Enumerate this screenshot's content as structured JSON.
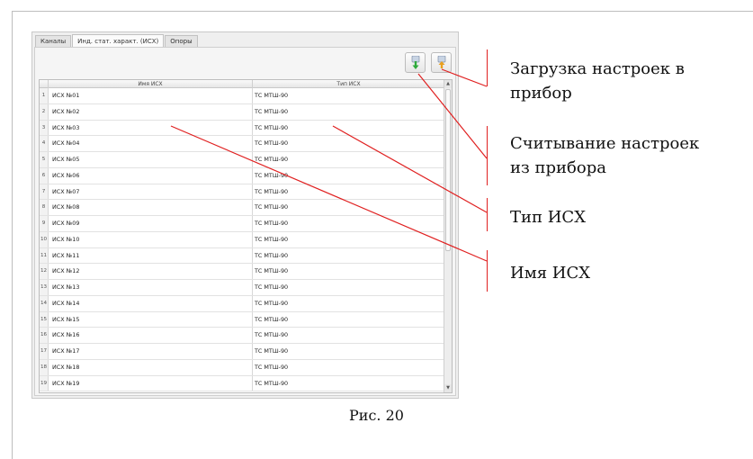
{
  "tabs": [
    {
      "label": "Каналы",
      "active": false
    },
    {
      "label": "Инд. стат. характ. (ИСХ)",
      "active": true
    },
    {
      "label": "Опоры",
      "active": false
    }
  ],
  "toolbar": {
    "load_icon": "download-to-device-icon",
    "read_icon": "read-from-device-icon",
    "load_arrow_color": "#2eaa3c",
    "read_arrow_color": "#e8a020"
  },
  "table": {
    "headers": [
      "Имя ИСХ",
      "Тип ИСХ"
    ],
    "rows": [
      {
        "num": "1",
        "name": "ИСХ №01",
        "type": "ТС МТШ-90"
      },
      {
        "num": "2",
        "name": "ИСХ №02",
        "type": "ТС МТШ-90"
      },
      {
        "num": "3",
        "name": "ИСХ №03",
        "type": "ТС МТШ-90"
      },
      {
        "num": "4",
        "name": "ИСХ №04",
        "type": "ТС МТШ-90"
      },
      {
        "num": "5",
        "name": "ИСХ №05",
        "type": "ТС МТШ-90"
      },
      {
        "num": "6",
        "name": "ИСХ №06",
        "type": "ТС МТШ-90"
      },
      {
        "num": "7",
        "name": "ИСХ №07",
        "type": "ТС МТШ-90"
      },
      {
        "num": "8",
        "name": "ИСХ №08",
        "type": "ТС МТШ-90"
      },
      {
        "num": "9",
        "name": "ИСХ №09",
        "type": "ТС МТШ-90"
      },
      {
        "num": "10",
        "name": "ИСХ №10",
        "type": "ТС МТШ-90"
      },
      {
        "num": "11",
        "name": "ИСХ №11",
        "type": "ТС МТШ-90"
      },
      {
        "num": "12",
        "name": "ИСХ №12",
        "type": "ТС МТШ-90"
      },
      {
        "num": "13",
        "name": "ИСХ №13",
        "type": "ТС МТШ-90"
      },
      {
        "num": "14",
        "name": "ИСХ №14",
        "type": "ТС МТШ-90"
      },
      {
        "num": "15",
        "name": "ИСХ №15",
        "type": "ТС МТШ-90"
      },
      {
        "num": "16",
        "name": "ИСХ №16",
        "type": "ТС МТШ-90"
      },
      {
        "num": "17",
        "name": "ИСХ №17",
        "type": "ТС МТШ-90"
      },
      {
        "num": "18",
        "name": "ИСХ №18",
        "type": "ТС МТШ-90"
      },
      {
        "num": "19",
        "name": "ИСХ №19",
        "type": "ТС МТШ-90"
      }
    ]
  },
  "callouts": {
    "load": [
      "Загрузка настроек в",
      "прибор"
    ],
    "read": [
      "Считывание настроек",
      "из прибора"
    ],
    "type": "Тип ИСХ",
    "name": "Имя ИСХ"
  },
  "caption": "Рис. 20",
  "colors": {
    "pointer": "#e02020"
  }
}
